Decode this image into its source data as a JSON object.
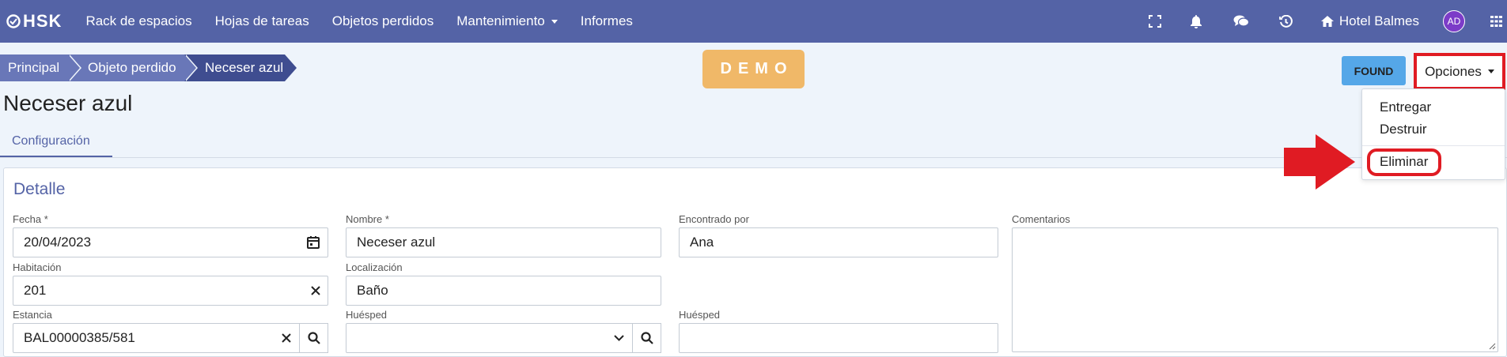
{
  "navbar": {
    "logo_text": "HSK",
    "links": [
      {
        "label": "Rack de espacios"
      },
      {
        "label": "Hojas de tareas"
      },
      {
        "label": "Objetos perdidos"
      },
      {
        "label": "Mantenimiento"
      },
      {
        "label": "Informes"
      }
    ],
    "hotel_name": "Hotel Balmes",
    "avatar_initials": "AD",
    "icons": [
      "expand-icon",
      "bell-icon",
      "chat-icon",
      "history-icon",
      "home-icon",
      "grid-menu-icon"
    ],
    "background_color": "#5463a6"
  },
  "breadcrumb": [
    {
      "label": "Principal"
    },
    {
      "label": "Objeto perdido"
    },
    {
      "label": "Neceser azul"
    }
  ],
  "demo_badge": "DEMO",
  "page_title": "Neceser azul",
  "tabs": [
    {
      "label": "Configuración",
      "active": true
    }
  ],
  "actions": {
    "found_label": "FOUND",
    "options_label": "Opciones",
    "options_menu": [
      {
        "label": "Entregar"
      },
      {
        "label": "Destruir"
      },
      {
        "label": "Eliminar",
        "highlighted": true
      }
    ]
  },
  "detail": {
    "title": "Detalle",
    "fields": {
      "fecha": {
        "label": "Fecha *",
        "value": "20/04/2023"
      },
      "nombre": {
        "label": "Nombre *",
        "value": "Neceser azul"
      },
      "encontrado_por": {
        "label": "Encontrado por",
        "value": "Ana"
      },
      "comentarios": {
        "label": "Comentarios",
        "value": ""
      },
      "habitacion": {
        "label": "Habitación",
        "value": "201"
      },
      "localizacion": {
        "label": "Localización",
        "value": "Baño"
      },
      "estancia": {
        "label": "Estancia",
        "value": "BAL00000385/581"
      },
      "huesped_select": {
        "label": "Huésped",
        "value": ""
      },
      "huesped_text": {
        "label": "Huésped",
        "value": ""
      }
    }
  },
  "colors": {
    "accent": "#5463a6",
    "highlight_red": "#e01b23",
    "found_button": "#55a7e8",
    "demo_badge": "#f0b868"
  }
}
